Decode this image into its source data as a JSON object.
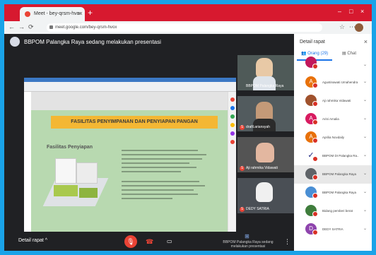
{
  "browser": {
    "tab_title": "Meet - bey-qrsm-hvox",
    "url": "meet.google.com/bey-qrsm-hvox",
    "new_tab": "+",
    "tab_close": "×"
  },
  "meet": {
    "presenter_text": "BBPOM Palangka Raya sedang melakukan presentasi",
    "shared_doc": {
      "banner": "FASILITAS PENYIMPANAN DAN PENYIAPAN PANGAN",
      "subtitle": "Fasilitas Penyiapan"
    },
    "tiles": [
      {
        "label": "BBPOM Palangka Raya",
        "badge": ""
      },
      {
        "label": "drafil.ariansyah",
        "badge": "S"
      },
      {
        "label": "Aji rahmika Vidawati",
        "badge": "S"
      },
      {
        "label": "DEDY SATRIA",
        "badge": "S"
      }
    ],
    "bottom": {
      "details": "Detail rapat",
      "details_chev": "^",
      "present_status": "BBPOM Palangka Raya sedang melakukan presentasi"
    }
  },
  "panel": {
    "title": "Detail rapat",
    "close": "×",
    "tab_people": "Orang (29)",
    "tab_chat": "Chat",
    "people": [
      {
        "name": "",
        "initial": "",
        "color": "#c2185b"
      },
      {
        "name": "Agustinawati Umahendra",
        "initial": "A",
        "color": "#e8710a"
      },
      {
        "name": "Aji rahmika Vidawati",
        "initial": "",
        "color": "#a0522d"
      },
      {
        "name": "Arini Amalia",
        "initial": "A",
        "color": "#d81b60"
      },
      {
        "name": "Aprilia Novdaily",
        "initial": "A",
        "color": "#e8710a"
      },
      {
        "name": "BBPOM DI Palangka Ra...",
        "initial": "✓",
        "color": "#ffffff"
      },
      {
        "name": "BBPOM Palangka Raya",
        "initial": "",
        "color": "#5f6368"
      },
      {
        "name": "BBPOM Palangka Raya",
        "initial": "",
        "color": "#4a8fd4"
      },
      {
        "name": "Bidang pemberi berat",
        "initial": "",
        "color": "#3f7d3c"
      },
      {
        "name": "DEDY SATRIA",
        "initial": "D",
        "color": "#8e44ad"
      }
    ]
  }
}
